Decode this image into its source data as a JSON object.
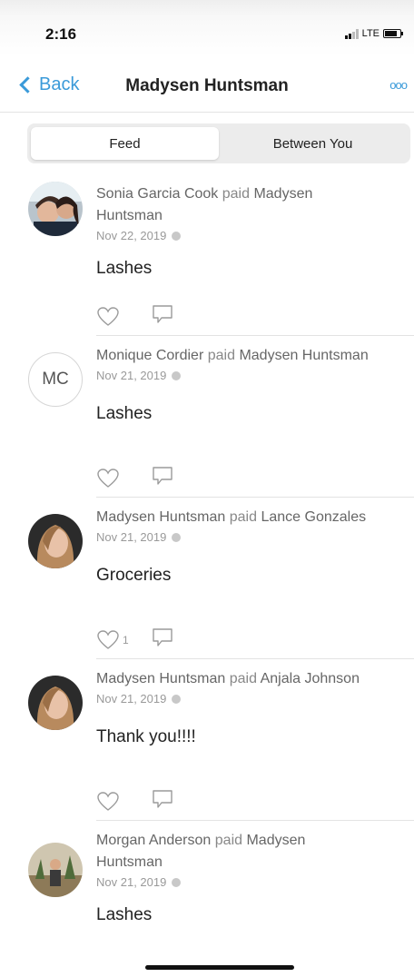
{
  "status_bar": {
    "time": "2:16",
    "network": "LTE"
  },
  "nav": {
    "back_label": "Back",
    "title": "Madysen Huntsman",
    "more": "ooo"
  },
  "tabs": [
    {
      "label": "Feed",
      "active": true
    },
    {
      "label": "Between You",
      "active": false
    }
  ],
  "feed": [
    {
      "actor": "Sonia Garcia Cook",
      "verb": "paid",
      "target": "Madysen",
      "target2": "Huntsman",
      "date": "Nov 22, 2019",
      "note": "Lashes",
      "likes": "",
      "avatar_initials": ""
    },
    {
      "actor": "Monique Cordier",
      "verb": "paid",
      "target": "Madysen Huntsman",
      "target2": "",
      "date": "Nov 21, 2019",
      "note": "Lashes",
      "likes": "",
      "avatar_initials": "MC"
    },
    {
      "actor": "Madysen Huntsman",
      "verb": "paid",
      "target": "Lance Gonzales",
      "target2": "",
      "date": "Nov 21, 2019",
      "note": "Groceries",
      "likes": "1",
      "avatar_initials": ""
    },
    {
      "actor": "Madysen Huntsman",
      "verb": "paid",
      "target": "Anjala Johnson",
      "target2": "",
      "date": "Nov 21, 2019",
      "note": "Thank you!!!!",
      "likes": "",
      "avatar_initials": ""
    },
    {
      "actor": "Morgan Anderson",
      "verb": "paid",
      "target": "Madysen",
      "target2": "Huntsman",
      "date": "Nov 21, 2019",
      "note": "Lashes",
      "likes": "",
      "avatar_initials": ""
    }
  ],
  "colors": {
    "accent": "#3a9ad9",
    "divider": "#e3e3e3",
    "segment_bg": "#ececec"
  }
}
